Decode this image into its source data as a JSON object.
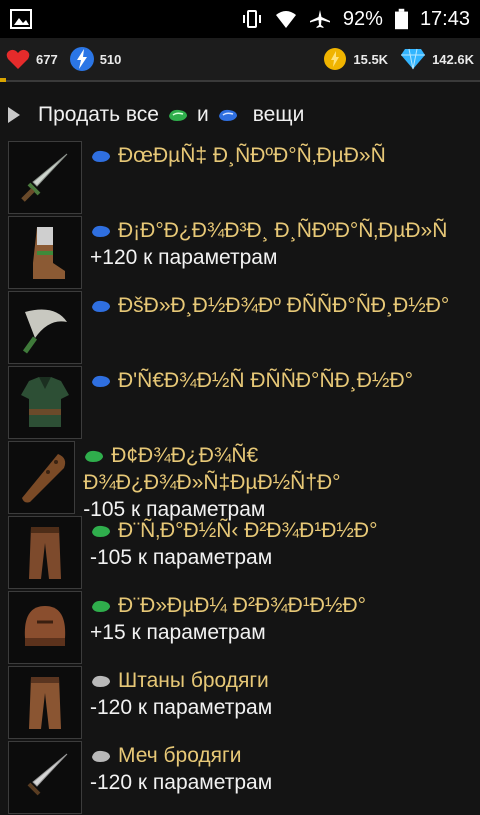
{
  "status": {
    "battery": "92%",
    "time": "17:43",
    "icons": [
      "image-icon",
      "vibrate-icon",
      "wifi-icon",
      "airplane-icon",
      "battery-icon"
    ]
  },
  "resources": {
    "health": "677",
    "energy": "510",
    "gold": "15.5K",
    "crystals": "142.6K"
  },
  "sell": {
    "prefix": "Продать все",
    "middle": "и",
    "suffix": "вещи"
  },
  "items": [
    {
      "name": "ÐœÐµÑ‡ Ð¸ÑÐºÐ°Ñ‚ÐµÐ»Ñ",
      "stat": "",
      "gem": "blue",
      "thumb": "sword-icon"
    },
    {
      "name": "Ð¡Ð°Ð¿Ð¾Ð³Ð¸ Ð¸ÑÐºÐ°Ñ‚ÐµÐ»Ñ",
      "stat": "+120 к параметрам",
      "gem": "blue",
      "thumb": "boots-icon"
    },
    {
      "name": "ÐšÐ»Ð¸Ð½Ð¾Ðº ÐÑÑÐ°ÑÐ¸Ð½Ð°",
      "stat": "",
      "gem": "blue",
      "thumb": "dagger-icon"
    },
    {
      "name": "Ð'Ñ€Ð¾Ð½Ñ ÐÑÑÐ°ÑÐ¸Ð½Ð°",
      "stat": "",
      "gem": "blue",
      "thumb": "armor-icon"
    },
    {
      "name": "Ð¢Ð¾Ð¿Ð¾Ñ€ Ð¾Ð¿Ð¾Ð»Ñ‡ÐµÐ½Ñ†Ð°",
      "stat": "-105 к параметрам",
      "gem": "green",
      "thumb": "club-icon"
    },
    {
      "name": "Ð¨Ñ‚Ð°Ð½Ñ‹ Ð²Ð¾Ð¹Ð½Ð°",
      "stat": "-105 к параметрам",
      "gem": "green",
      "thumb": "pants-icon"
    },
    {
      "name": "Ð¨Ð»ÐµÐ¼ Ð²Ð¾Ð¹Ð½Ð°",
      "stat": "+15 к параметрам",
      "gem": "green",
      "thumb": "helmet-icon"
    },
    {
      "name": "Штаны бродяги",
      "stat": "-120 к параметрам",
      "gem": "gray",
      "thumb": "pants-icon"
    },
    {
      "name": "Меч бродяги",
      "stat": "-120 к параметрам",
      "gem": "gray",
      "thumb": "sword-icon"
    }
  ],
  "colors": {
    "name": "#e7c877",
    "blue_gem": "#2f6fe0",
    "green_gem": "#2fae4c",
    "gray_gem": "#b9b9b9"
  }
}
